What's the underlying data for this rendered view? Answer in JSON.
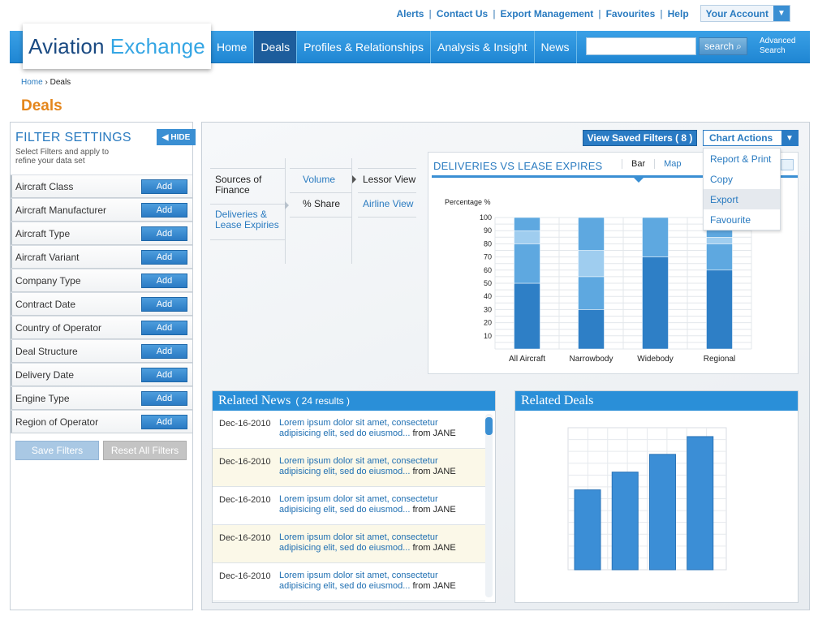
{
  "utility": {
    "links": [
      "Alerts",
      "Contact Us",
      "Export Management",
      "Favourites",
      "Help"
    ],
    "account_label": "Your Account"
  },
  "logo": {
    "part1": "Aviation",
    "part2": "Exchange"
  },
  "nav": {
    "items": [
      "Home",
      "Deals",
      "Profiles & Relationships",
      "Analysis & Insight",
      "News"
    ],
    "active_index": 1,
    "search_value": "",
    "search_label": "search",
    "advanced_line1": "Advanced",
    "advanced_line2": "Search"
  },
  "breadcrumb": {
    "home": "Home",
    "separator": "›",
    "current": "Deals"
  },
  "page_title": "Deals",
  "filters": {
    "title": "FILTER SETTINGS",
    "subtitle": "Select Filters and apply to refine your data set",
    "hide_label": "HIDE",
    "add_label": "Add",
    "items": [
      "Aircraft Class",
      "Aircraft Manufacturer",
      "Aircraft Type",
      "Aircraft Variant",
      "Company Type",
      "Contract Date",
      "Country of Operator",
      "Deal Structure",
      "Delivery Date",
      "Engine Type",
      "Region of Operator"
    ],
    "save_label": "Save Filters",
    "reset_label": "Reset All Filters"
  },
  "main": {
    "view_saved_filters": "View Saved Filters ( 8 )",
    "chart_actions": {
      "label": "Chart Actions",
      "menu": [
        "Report & Print",
        "Copy",
        "Export",
        "Favourite"
      ],
      "highlighted": "Export"
    },
    "tree": {
      "col1": [
        "Sources of Finance",
        "Deliveries & Lease Expiries"
      ],
      "col2": [
        "Volume",
        "% Share"
      ],
      "col3": [
        "Lessor View",
        "Airline View"
      ]
    },
    "chart_box": {
      "title": "DELIVERIES VS LEASE EXPIRES",
      "tabs": [
        "Bar",
        "Map"
      ],
      "active_tab": "Bar"
    }
  },
  "news": {
    "title": "Related News",
    "count": "( 24 results )",
    "items": [
      {
        "date": "Dec-16-2010",
        "text": "Lorem ipsum dolor sit amet, consectetur adipisicing elit, sed do eiusmod...",
        "from": "from JANE"
      },
      {
        "date": "Dec-16-2010",
        "text": "Lorem ipsum dolor sit amet, consectetur adipisicing elit, sed do eiusmod...",
        "from": "from JANE"
      },
      {
        "date": "Dec-16-2010",
        "text": "Lorem ipsum dolor sit amet, consectetur adipisicing elit, sed do eiusmod...",
        "from": "from JANE"
      },
      {
        "date": "Dec-16-2010",
        "text": "Lorem ipsum dolor sit amet, consectetur adipisicing elit, sed do eiusmod...",
        "from": "from JANE"
      },
      {
        "date": "Dec-16-2010",
        "text": "Lorem ipsum dolor sit amet, consectetur adipisicing elit, sed do eiusmod...",
        "from": "from JANE"
      }
    ]
  },
  "deals": {
    "title": "Related Deals"
  },
  "colors": {
    "brand": "#2a8fd8",
    "accent": "#e4861c",
    "nav_active": "#1d5d9c"
  },
  "chart_data": [
    {
      "type": "bar",
      "stacked": true,
      "ylabel": "Percentage %",
      "ylim": [
        0,
        100
      ],
      "yticks": [
        10,
        20,
        30,
        40,
        50,
        60,
        70,
        80,
        90,
        100
      ],
      "categories": [
        "All Aircraft",
        "Narrowbody",
        "Widebody",
        "Regional"
      ],
      "series": [
        {
          "color": "#2e7fc6",
          "values": [
            50,
            30,
            70,
            60
          ]
        },
        {
          "color": "#5ea8e0",
          "values": [
            30,
            25,
            0,
            20
          ]
        },
        {
          "color": "#9fcdef",
          "values": [
            10,
            20,
            0,
            5
          ]
        },
        {
          "color": "#5ea8e0",
          "values": [
            10,
            25,
            30,
            15
          ]
        }
      ],
      "grid": true
    },
    {
      "type": "bar",
      "values": [
        45,
        55,
        65,
        75
      ],
      "ylim": [
        0,
        80
      ],
      "grid": true
    }
  ]
}
